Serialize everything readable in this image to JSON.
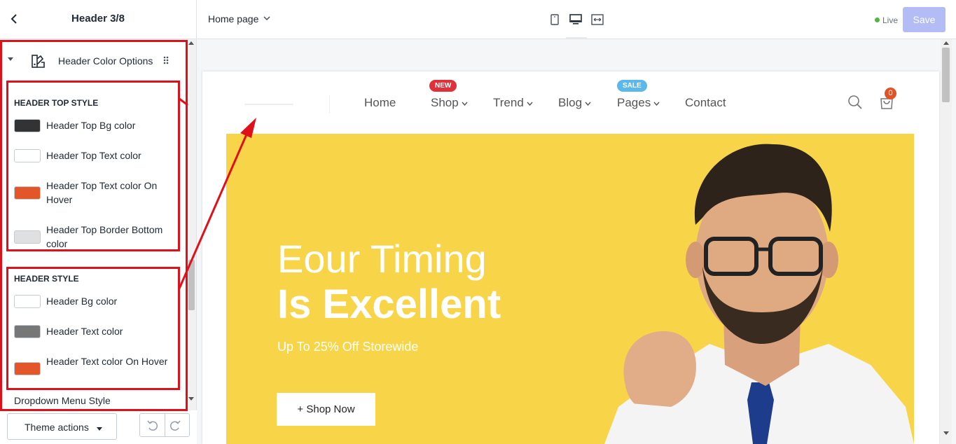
{
  "sidebar": {
    "title": "Header 3/8",
    "section": {
      "label": "Header Color Options"
    },
    "groups": [
      {
        "heading": "HEADER TOP STYLE",
        "options": [
          {
            "label": "Header Top Bg color",
            "color": "#333333"
          },
          {
            "label": "Header Top Text color",
            "color": "#ffffff"
          },
          {
            "label": "Header Top Text color On Hover",
            "color": "#e3562a"
          },
          {
            "label": "Header Top Border Bottom color",
            "color": "#e0e0e0"
          }
        ]
      },
      {
        "heading": "HEADER STYLE",
        "options": [
          {
            "label": "Header Bg color",
            "color": "#ffffff"
          },
          {
            "label": "Header Text color",
            "color": "#777777"
          },
          {
            "label": "Header Text color On Hover",
            "color": "#e3562a"
          }
        ]
      }
    ],
    "next_section": "Dropdown Menu Style",
    "footer": {
      "theme_actions": "Theme actions"
    }
  },
  "topbar": {
    "page_select": "Home page",
    "status": "Live",
    "save": "Save"
  },
  "preview": {
    "nav": [
      {
        "label": "Home",
        "dropdown": false,
        "badge": ""
      },
      {
        "label": "Shop",
        "dropdown": true,
        "badge": "NEW"
      },
      {
        "label": "Trend",
        "dropdown": true,
        "badge": ""
      },
      {
        "label": "Blog",
        "dropdown": true,
        "badge": ""
      },
      {
        "label": "Pages",
        "dropdown": true,
        "badge": "SALE"
      },
      {
        "label": "Contact",
        "dropdown": false,
        "badge": ""
      }
    ],
    "cart_count": "0",
    "hero": {
      "line1": "Eour Timing",
      "line2": "Is Excellent",
      "subtitle": "Up To 25% Off Storewide",
      "button": "+ Shop Now",
      "background": "#f8d548"
    }
  },
  "colors": {
    "highlight": "#e0101a",
    "accent": "#e3562a",
    "live": "#50b83c",
    "save_disabled": "#b3bcf5"
  }
}
